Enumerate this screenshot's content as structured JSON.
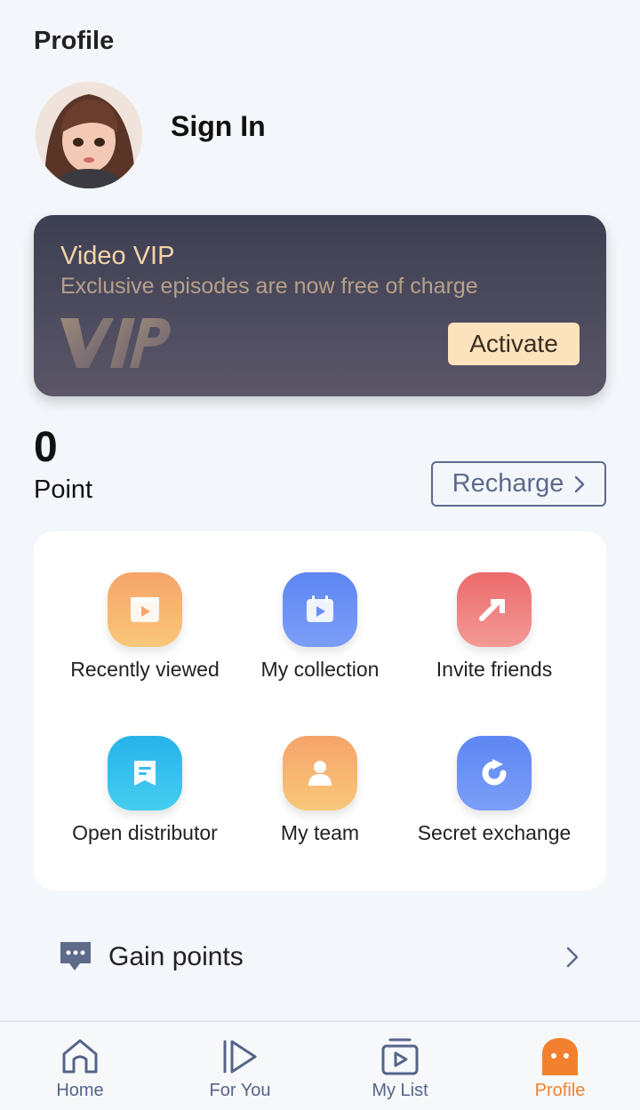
{
  "header": {
    "title": "Profile"
  },
  "user": {
    "sign_in_label": "Sign In"
  },
  "vip": {
    "title": "Video VIP",
    "subtitle": "Exclusive episodes are now free of charge",
    "activate_label": "Activate"
  },
  "points": {
    "value": "0",
    "label": "Point",
    "recharge_label": "Recharge"
  },
  "features": [
    {
      "label": "Recently viewed",
      "icon": "film-icon"
    },
    {
      "label": "My collection",
      "icon": "calendar-play-icon"
    },
    {
      "label": "Invite friends",
      "icon": "share-arrow-icon"
    },
    {
      "label": "Open distributor",
      "icon": "bookmark-doc-icon"
    },
    {
      "label": "My team",
      "icon": "person-icon"
    },
    {
      "label": "Secret exchange",
      "icon": "exchange-icon"
    }
  ],
  "gain": {
    "label": "Gain points"
  },
  "tabs": [
    {
      "label": "Home"
    },
    {
      "label": "For You"
    },
    {
      "label": "My List"
    },
    {
      "label": "Profile",
      "active": true
    }
  ],
  "colors": {
    "accent": "#f1812f",
    "nav": "#56648a",
    "vip_gold": "#f6d3a9",
    "activate_bg": "#fde3bd"
  }
}
